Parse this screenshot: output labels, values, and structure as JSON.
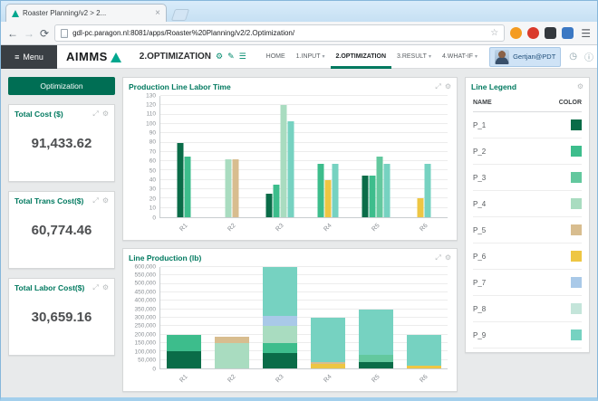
{
  "browser": {
    "tab_title": "Roaster Planning/v2 > 2...",
    "url": "gdl-pc.paragon.nl:8081/apps/Roaster%20Planning/v2/2.Optimization/"
  },
  "icons": {
    "close": "×",
    "back": "←",
    "forward": "→",
    "reload": "⟳",
    "star": "☆",
    "hamburger": "☰",
    "menu": "≡",
    "gear": "⚙",
    "pencil": "✎",
    "list": "☰",
    "expand": "⤢",
    "caret": "▾",
    "clock": "◷",
    "info": "ⓘ"
  },
  "header": {
    "menu_label": "Menu",
    "logo_text": "AIMMS",
    "page_title": "2.OPTIMIZATION",
    "nav": [
      {
        "label": "HOME",
        "dropdown": false,
        "active": false
      },
      {
        "label": "1.INPUT",
        "dropdown": true,
        "active": false
      },
      {
        "label": "2.OPTIMIZATION",
        "dropdown": false,
        "active": true
      },
      {
        "label": "3.RESULT",
        "dropdown": true,
        "active": false
      },
      {
        "label": "4.WHAT-IF",
        "dropdown": true,
        "active": false
      }
    ],
    "user": "Gertjan@PDT"
  },
  "sidebar": {
    "page_button": "Optimization",
    "cards": [
      {
        "title": "Total Cost ($)",
        "value": "91,433.62"
      },
      {
        "title": "Total Trans Cost($)",
        "value": "60,774.46"
      },
      {
        "title": "Total Labor Cost($)",
        "value": "30,659.16"
      }
    ]
  },
  "legend": {
    "title": "Line Legend",
    "headers": [
      "NAME",
      "COLOR"
    ],
    "rows": [
      {
        "name": "P_1",
        "color": "#0a6c48"
      },
      {
        "name": "P_2",
        "color": "#3dbd8c"
      },
      {
        "name": "P_3",
        "color": "#63c89e"
      },
      {
        "name": "P_4",
        "color": "#a9dcc0"
      },
      {
        "name": "P_5",
        "color": "#d8bd8f"
      },
      {
        "name": "P_6",
        "color": "#eec643"
      },
      {
        "name": "P_7",
        "color": "#a9c9e8"
      },
      {
        "name": "P_8",
        "color": "#c4e5da"
      },
      {
        "name": "P_9",
        "color": "#76d2c1"
      }
    ]
  },
  "chart_data": [
    {
      "type": "bar",
      "title": "Production Line Labor Time",
      "categories": [
        "R1",
        "R2",
        "R3",
        "R4",
        "R5",
        "R6"
      ],
      "ylim": [
        0,
        130
      ],
      "ytick": 10,
      "grid": true,
      "legend_position": "separate-widget",
      "groups": [
        [
          {
            "p": "P_1",
            "v": 80
          },
          {
            "p": "P_2",
            "v": 65
          }
        ],
        [
          {
            "p": "P_4",
            "v": 62
          },
          {
            "p": "P_5",
            "v": 62
          }
        ],
        [
          {
            "p": "P_1",
            "v": 25
          },
          {
            "p": "P_2",
            "v": 35
          },
          {
            "p": "P_4",
            "v": 120
          },
          {
            "p": "P_9",
            "v": 103
          }
        ],
        [
          {
            "p": "P_2",
            "v": 57
          },
          {
            "p": "P_6",
            "v": 40
          },
          {
            "p": "P_9",
            "v": 57
          }
        ],
        [
          {
            "p": "P_1",
            "v": 45
          },
          {
            "p": "P_2",
            "v": 45
          },
          {
            "p": "P_3",
            "v": 65
          },
          {
            "p": "P_9",
            "v": 57
          }
        ],
        [
          {
            "p": "P_6",
            "v": 20
          },
          {
            "p": "P_9",
            "v": 57
          }
        ]
      ]
    },
    {
      "type": "stacked-bar",
      "title": "Line Production (lb)",
      "categories": [
        "R1",
        "R2",
        "R3",
        "R4",
        "R5",
        "R6"
      ],
      "ylim": [
        0,
        600000
      ],
      "ytick": 50000,
      "grid": true,
      "legend_position": "separate-widget",
      "stacks": [
        [
          {
            "p": "P_1",
            "v": 100000
          },
          {
            "p": "P_2",
            "v": 100000
          }
        ],
        [
          {
            "p": "P_4",
            "v": 150000
          },
          {
            "p": "P_5",
            "v": 35000
          }
        ],
        [
          {
            "p": "P_1",
            "v": 90000
          },
          {
            "p": "P_2",
            "v": 60000
          },
          {
            "p": "P_4",
            "v": 100000
          },
          {
            "p": "P_7",
            "v": 60000
          },
          {
            "p": "P_9",
            "v": 290000
          }
        ],
        [
          {
            "p": "P_6",
            "v": 25000
          },
          {
            "p": "P_5",
            "v": 15000
          },
          {
            "p": "P_9",
            "v": 260000
          }
        ],
        [
          {
            "p": "P_1",
            "v": 40000
          },
          {
            "p": "P_3",
            "v": 40000
          },
          {
            "p": "P_9",
            "v": 270000
          }
        ],
        [
          {
            "p": "P_6",
            "v": 15000
          },
          {
            "p": "P_9",
            "v": 185000
          }
        ]
      ]
    }
  ],
  "theme": {
    "accent": "#00795f",
    "button_green": "#006e54"
  }
}
